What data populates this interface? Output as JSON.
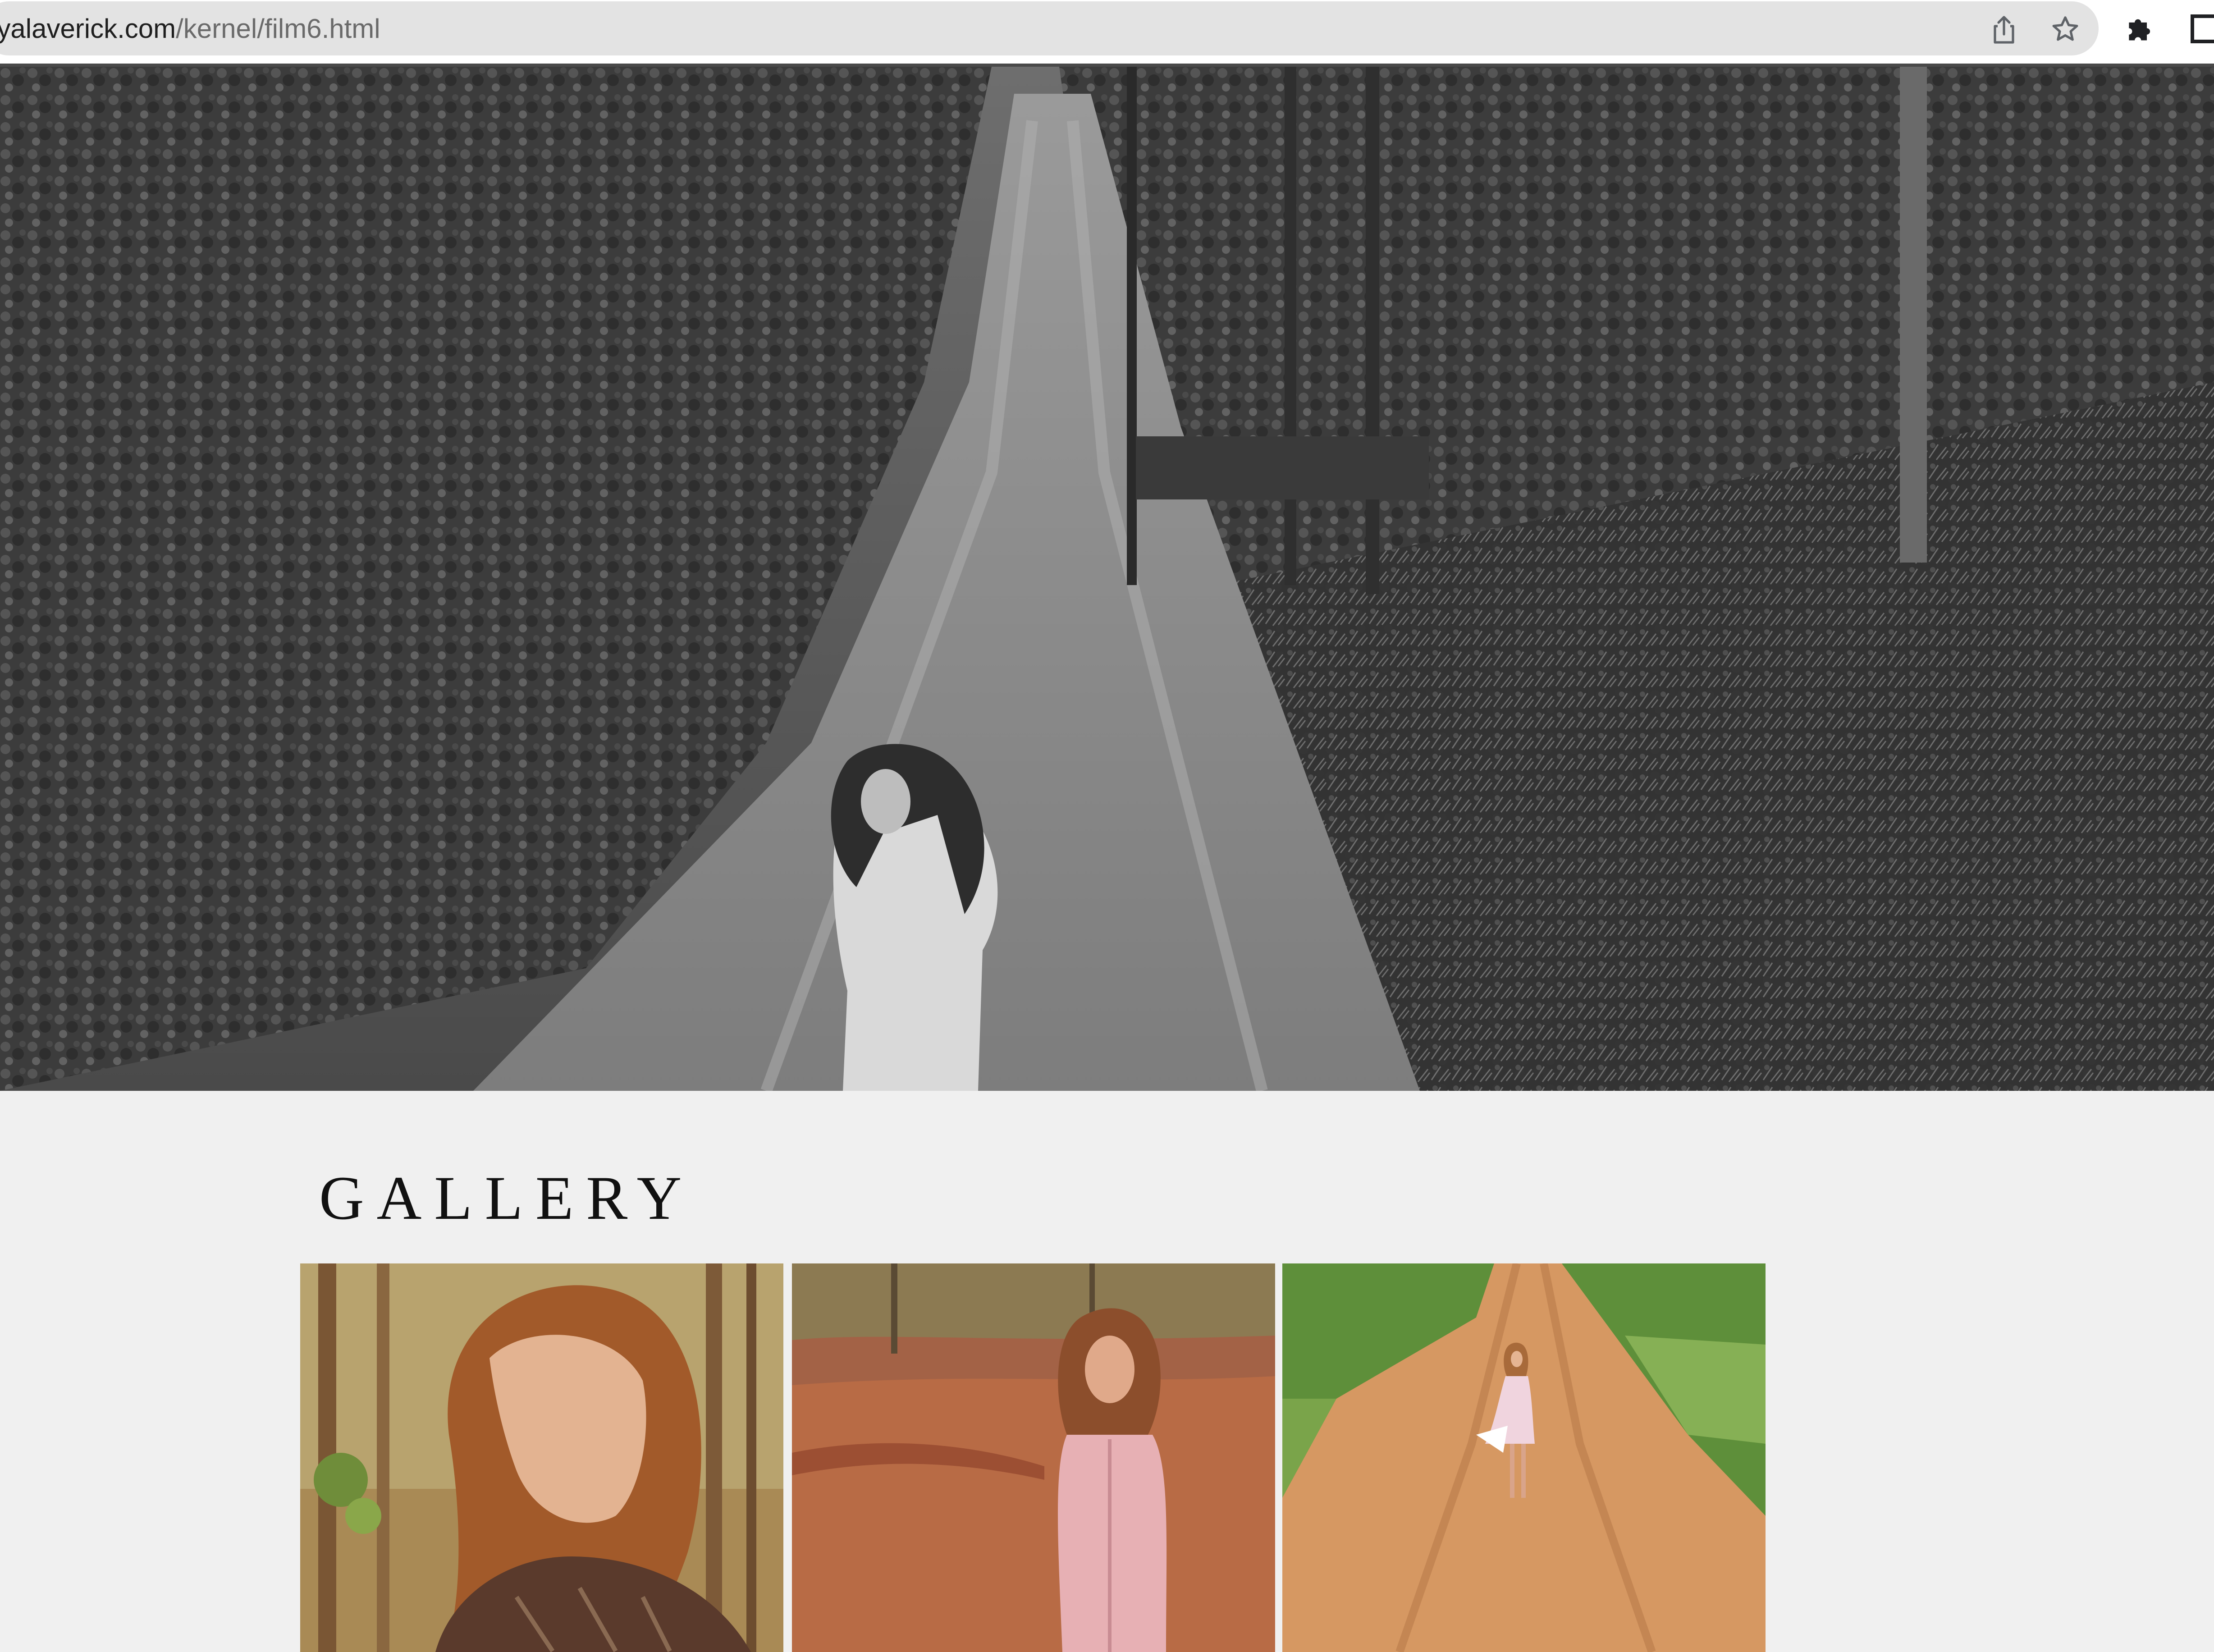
{
  "browser": {
    "url_host": "eyalaverick.com",
    "url_path": "/kernel/film6.html",
    "icons": [
      "share-icon",
      "star-icon",
      "puzzle-icon",
      "window-icon"
    ]
  },
  "hero": {
    "image": "hero-image",
    "style": "black-and-white photograph of a woman standing on a dirt road through dense forest"
  },
  "gallery": {
    "heading": "GALLERY",
    "thumbnails": [
      {
        "image": "gallery-thumb-1"
      },
      {
        "image": "gallery-thumb-2"
      },
      {
        "image": "gallery-thumb-3"
      }
    ]
  },
  "colors": {
    "page_background": "#f0f0f0",
    "omnibox": "#e3e3e3",
    "heading_text": "#111111",
    "dirt_road": "#c98a57",
    "foliage": "#5e8f3a"
  }
}
